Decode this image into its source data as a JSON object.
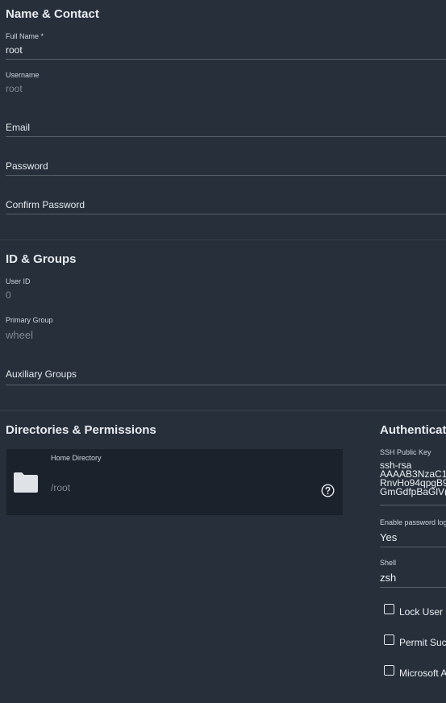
{
  "name_contact": {
    "title": "Name & Contact",
    "full_name": {
      "label": "Full Name *",
      "value": "root"
    },
    "username": {
      "label": "Username",
      "value": "root"
    },
    "email": {
      "placeholder": "Email"
    },
    "password": {
      "placeholder": "Password"
    },
    "confirm_password": {
      "placeholder": "Confirm Password"
    }
  },
  "id_groups": {
    "title": "ID & Groups",
    "user_id": {
      "label": "User ID",
      "value": "0"
    },
    "primary_group": {
      "label": "Primary Group",
      "value": "wheel"
    },
    "auxiliary_groups": {
      "placeholder": "Auxiliary Groups"
    }
  },
  "directories": {
    "title": "Directories & Permissions",
    "home_directory": {
      "label": "Home Directory",
      "value": "/root"
    }
  },
  "authentication": {
    "title": "Authenticati",
    "ssh_key": {
      "label": "SSH Public Key",
      "lines": [
        "ssh-rsa",
        "AAAAB3NzaC1",
        "RnvHo94qpgB9",
        "GmGdfpBaGlV("
      ]
    },
    "enable_password_login": {
      "label": "Enable password log",
      "value": "Yes"
    },
    "shell": {
      "label": "Shell",
      "value": "zsh"
    },
    "checkboxes": [
      {
        "label": "Lock User",
        "checked": false
      },
      {
        "label": "Permit Suc",
        "checked": false
      },
      {
        "label": "Microsoft A",
        "checked": false
      }
    ]
  },
  "colors": {
    "background": "#262f3a",
    "card": "#1b222b",
    "line": "#56606b"
  }
}
